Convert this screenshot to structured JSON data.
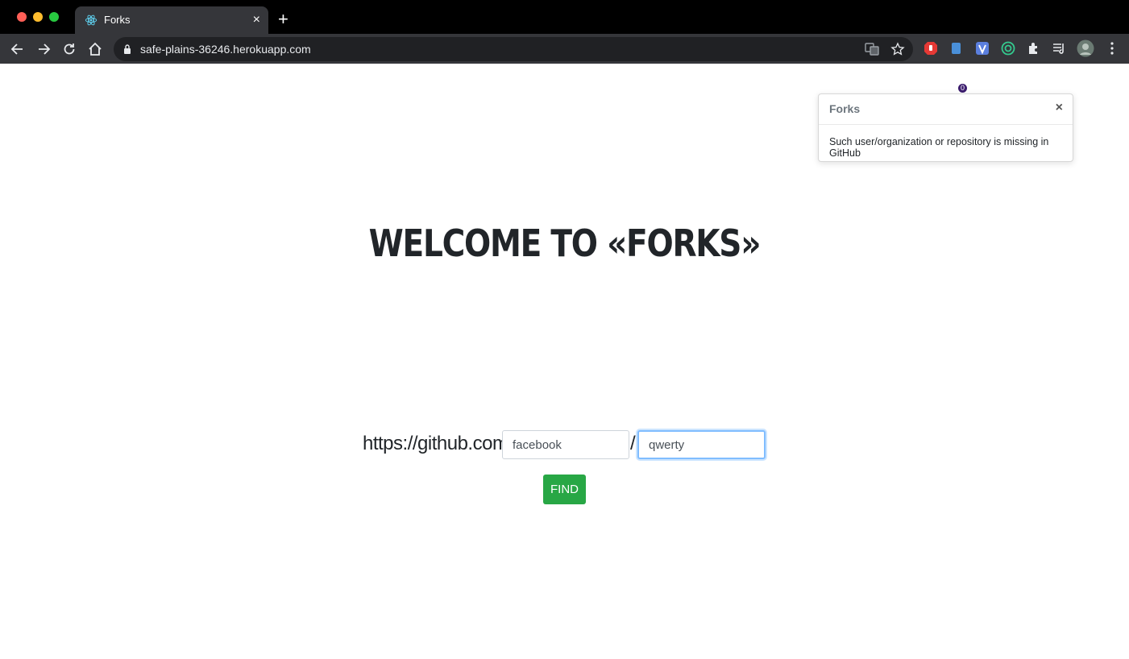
{
  "browser": {
    "tab": {
      "title": "Forks",
      "close_symbol": "×"
    },
    "new_tab_symbol": "+",
    "address": {
      "url": "safe-plains-36246.herokuapp.com"
    },
    "extensions": {
      "badge_count": "0"
    }
  },
  "page": {
    "heading": "WELCOME TO «FORKS»",
    "form": {
      "prefix": "https://github.com/",
      "separator": "/",
      "user_value": "facebook",
      "repo_value": "qwerty",
      "find_label": "FIND"
    },
    "toast": {
      "title": "Forks",
      "close_symbol": "×",
      "message": "Such user/organization or repository is missing in GitHub"
    }
  },
  "colors": {
    "find_button": "#28a745",
    "focus_border": "#80bdff",
    "heading_text": "#212529"
  }
}
